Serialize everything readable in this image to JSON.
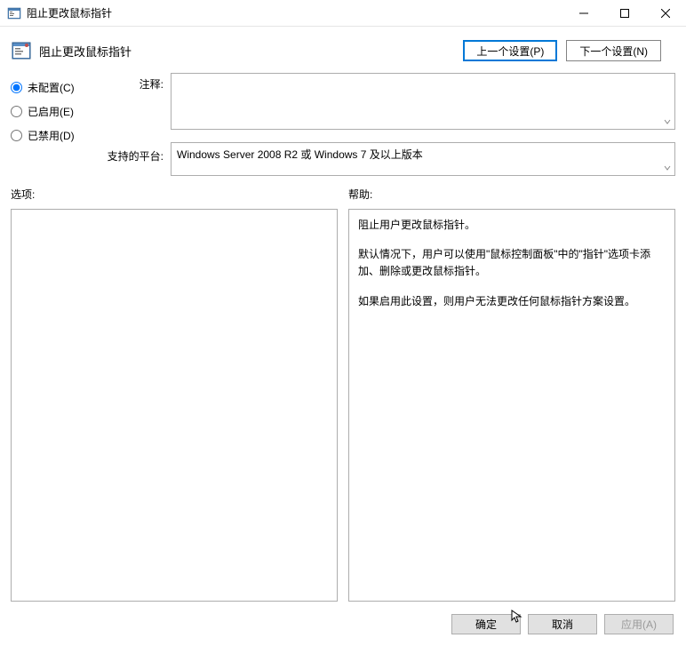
{
  "window": {
    "title": "阻止更改鼠标指针"
  },
  "subtitle": "阻止更改鼠标指针",
  "nav": {
    "prev": "上一个设置(P)",
    "next": "下一个设置(N)"
  },
  "radios": {
    "unconfigured": "未配置(C)",
    "enabled": "已启用(E)",
    "disabled": "已禁用(D)",
    "selected": "unconfigured"
  },
  "labels": {
    "comment": "注释:",
    "platforms": "支持的平台:",
    "options": "选项:",
    "help": "帮助:"
  },
  "platform_text": "Windows Server 2008 R2 或 Windows 7 及以上版本",
  "help": {
    "p1": "阻止用户更改鼠标指针。",
    "p2": "默认情况下，用户可以使用\"鼠标控制面板\"中的\"指针\"选项卡添加、删除或更改鼠标指针。",
    "p3": "如果启用此设置，则用户无法更改任何鼠标指针方案设置。"
  },
  "buttons": {
    "ok": "确定",
    "cancel": "取消",
    "apply": "应用(A)"
  },
  "icons": {
    "title_icon": "policy-icon",
    "subtitle_icon": "policy-icon"
  }
}
